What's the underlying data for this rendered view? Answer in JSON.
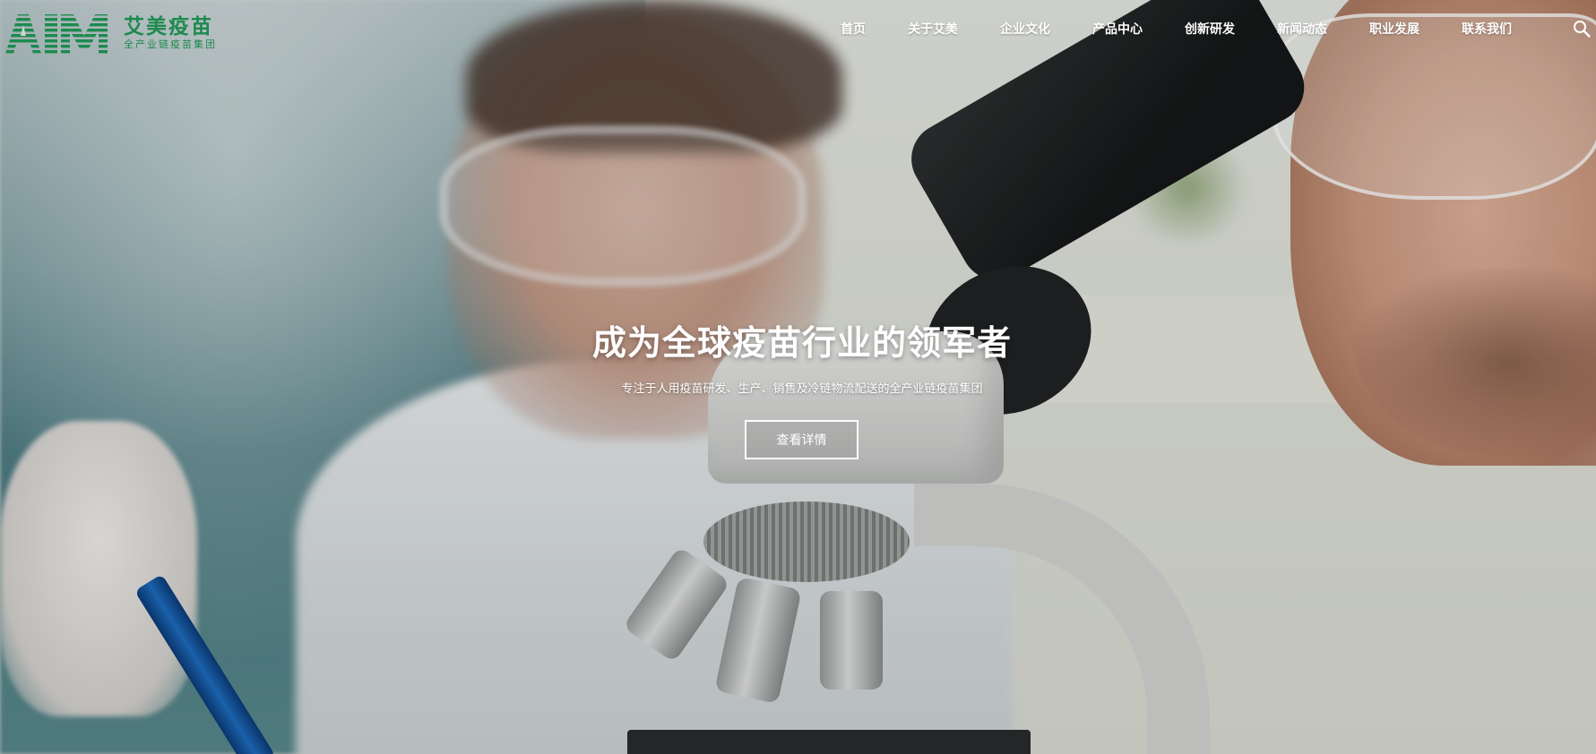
{
  "brand": {
    "logo_letters": "AIM",
    "name": "艾美疫苗",
    "tagline": "全产业链疫苗集团",
    "color": "#1d8a4e"
  },
  "nav": {
    "items": [
      {
        "label": "首页"
      },
      {
        "label": "关于艾美"
      },
      {
        "label": "企业文化"
      },
      {
        "label": "产品中心"
      },
      {
        "label": "创新研发"
      },
      {
        "label": "新闻动态"
      },
      {
        "label": "职业发展"
      },
      {
        "label": "联系我们"
      }
    ],
    "search_icon": "search-icon"
  },
  "hero": {
    "title": "成为全球疫苗行业的领军者",
    "subtitle": "专注于人用疫苗研发、生产、销售及冷链物流配送的全产业链疫苗集团",
    "button_label": "查看详情"
  }
}
